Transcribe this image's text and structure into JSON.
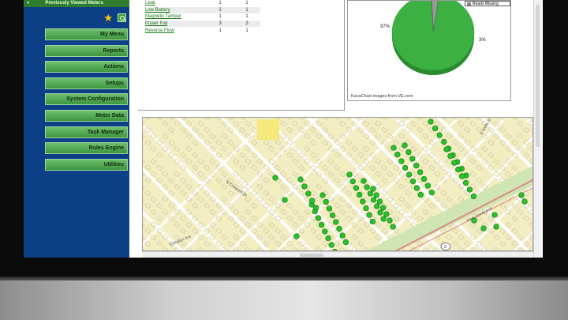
{
  "sidebar": {
    "header": "Previously Viewed Meters",
    "items": [
      {
        "label": "My Menu"
      },
      {
        "label": "Reports"
      },
      {
        "label": "Actions"
      },
      {
        "label": "Setups"
      },
      {
        "label": "System Configuration"
      },
      {
        "label": "Meter Data"
      },
      {
        "label": "Task Manager"
      },
      {
        "label": "Rules Engine"
      },
      {
        "label": "Utilities"
      }
    ]
  },
  "alarm_table": {
    "rows": [
      {
        "name": "Leak",
        "v1": "1",
        "v2": "1"
      },
      {
        "name": "Low Battery",
        "v1": "1",
        "v2": "1"
      },
      {
        "name": "Magnetic Tamper",
        "v1": "1",
        "v2": "1"
      },
      {
        "name": "Power Fail",
        "v1": "3",
        "v2": "3"
      },
      {
        "name": "Reverse Flow",
        "v1": "1",
        "v2": "1"
      }
    ]
  },
  "chart_data": {
    "type": "pie",
    "categories": [
      "",
      "Reads Missing"
    ],
    "values": [
      97,
      3
    ],
    "slice_labels": [
      "97%",
      "3%"
    ],
    "colors": [
      "#3cb043",
      "#9a9a9a"
    ],
    "legend": "top-right",
    "credit": "KavaChart images from VE.com"
  },
  "map": {
    "street_labels": [
      "N Crescent Dr",
      "Irvington Ave",
      "Park Grove Ave",
      "N Wells St"
    ],
    "shield_label": "2",
    "marker_color": "#2dc02d"
  }
}
